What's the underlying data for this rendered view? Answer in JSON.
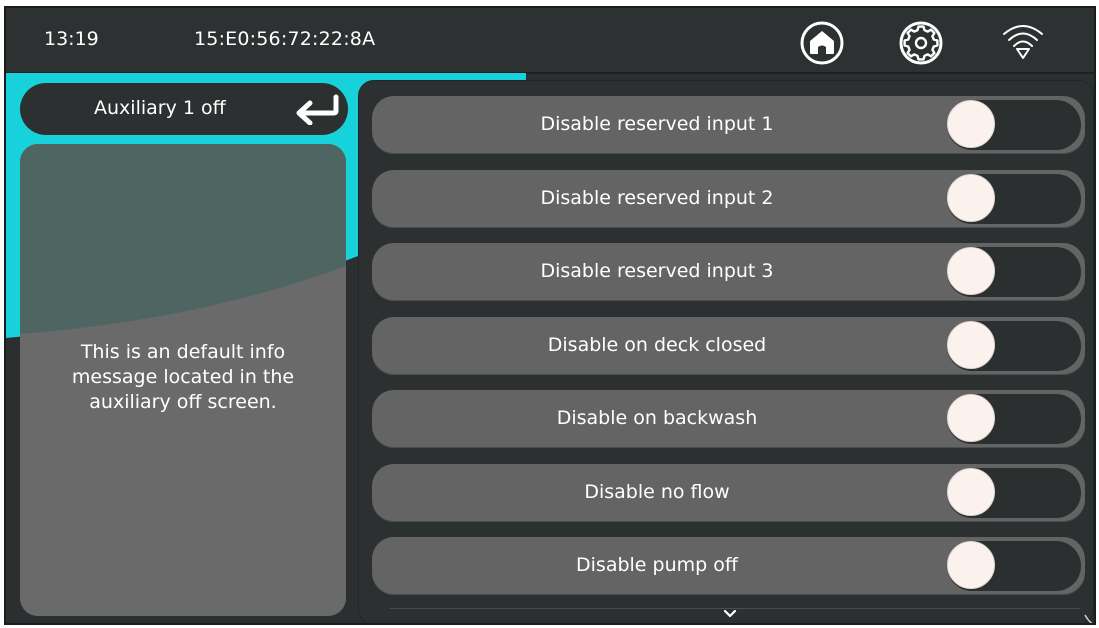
{
  "status_bar": {
    "time": "13:19",
    "device_id": "15:E0:56:72:22:8A"
  },
  "header": {
    "title": "Auxiliary 1 off"
  },
  "info": {
    "message_line1": "This is an default info",
    "message_line2": "message located in the",
    "message_line3": "auxiliary off screen."
  },
  "settings": [
    {
      "label": "Disable reserved input 1",
      "enabled": false
    },
    {
      "label": "Disable reserved input 2",
      "enabled": false
    },
    {
      "label": "Disable reserved input 3",
      "enabled": false
    },
    {
      "label": "Disable on deck closed",
      "enabled": false
    },
    {
      "label": "Disable on backwash",
      "enabled": false
    },
    {
      "label": "Disable no flow",
      "enabled": false
    },
    {
      "label": "Disable pump off",
      "enabled": false
    }
  ],
  "icons": {
    "home": "home-icon",
    "settings": "gear-icon",
    "wifi": "wifi-icon",
    "back": "return-arrow-icon",
    "scroll": "chevron-down-icon"
  },
  "colors": {
    "accent": "#17d2da",
    "background": "#2b2f30",
    "row": "#646464",
    "knob": "#fbf2ee"
  }
}
